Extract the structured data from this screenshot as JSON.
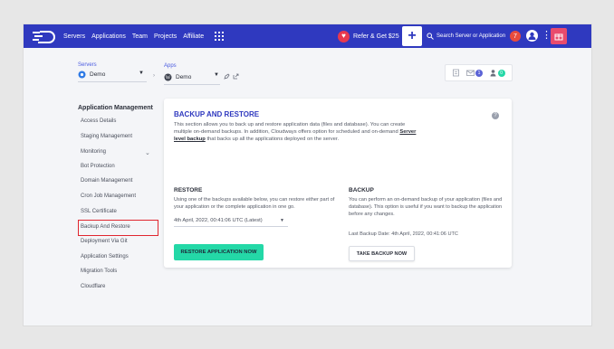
{
  "nav": {
    "items": [
      "Servers",
      "Applications",
      "Team",
      "Projects",
      "Affiliate"
    ],
    "refer_label": "Refer & Get $25",
    "search_placeholder": "Search Server or Application",
    "notification_count": "7"
  },
  "selectors": {
    "servers_label": "Servers",
    "server_value": "Demo",
    "apps_label": "Apps",
    "app_value": "Demo",
    "icon_counts": {
      "mail": "1",
      "users": "0"
    }
  },
  "sidebar": {
    "title": "Application Management",
    "items": [
      "Access Details",
      "Staging Management",
      "Monitoring",
      "Bot Protection",
      "Domain Management",
      "Cron Job Management",
      "SSL Certificate",
      "Backup And Restore",
      "Deployment Via Git",
      "Application Settings",
      "Migration Tools",
      "Cloudflare"
    ],
    "active_item": "Backup And Restore"
  },
  "card": {
    "title": "BACKUP AND RESTORE",
    "desc_1": "This section allows you to back up and restore application data (files and database). You can create multiple on-demand backups. In addition, Cloudways offers option for scheduled and on-demand",
    "desc_link": "Server level backup",
    "desc_2": "that backs up all the applications deployed on the server.",
    "restore": {
      "title": "RESTORE",
      "text": "Using one of the backups available below, you can restore either part of your application or the complete application in one go.",
      "selected_backup": "4th April, 2022, 00:41:06 UTC (Latest)",
      "button": "RESTORE APPLICATION NOW"
    },
    "backup": {
      "title": "BACKUP",
      "text": "You can perform an on-demand backup of your application (files and database). This option is useful if you want to backup the application before any changes.",
      "last_backup": "Last Backup Date: 4th April, 2022, 00:41:06 UTC",
      "button": "TAKE BACKUP NOW"
    }
  },
  "colors": {
    "nav_bg": "#2f39bf",
    "accent_green": "#24d8a7",
    "highlight_red": "#e0262f"
  }
}
